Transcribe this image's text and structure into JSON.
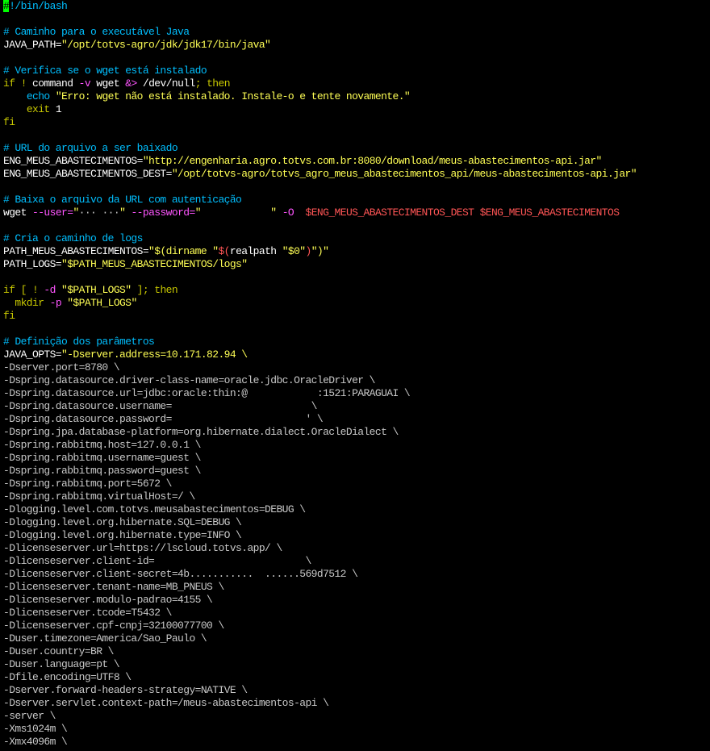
{
  "colors": {
    "background": "#000000",
    "comment": "#00bfff",
    "keyword": "#c8c800",
    "string": "#ffff99",
    "variable": "#ff5555",
    "text": "#ffffff",
    "option": "#c8c8c8",
    "cursor": "#00ff00"
  },
  "lines": [
    [
      {
        "t": "#",
        "c": "cursor"
      },
      {
        "t": "!/bin/bash",
        "c": "cyan"
      }
    ],
    [],
    [
      {
        "t": "# Caminho para o executável Java",
        "c": "cyan"
      }
    ],
    [
      {
        "t": "JAVA_PATH=",
        "c": "white"
      },
      {
        "t": "\"/opt/totvs-agro/jdk/jdk17/bin/java\"",
        "c": "yellow"
      }
    ],
    [],
    [
      {
        "t": "# Verifica se o wget está instalado",
        "c": "cyan"
      }
    ],
    [
      {
        "t": "if ! ",
        "c": "kw"
      },
      {
        "t": "command ",
        "c": "white"
      },
      {
        "t": "-v ",
        "c": "magenta"
      },
      {
        "t": "wget ",
        "c": "white"
      },
      {
        "t": "&> ",
        "c": "magenta"
      },
      {
        "t": "/dev/null",
        "c": "white"
      },
      {
        "t": "; then",
        "c": "kw"
      }
    ],
    [
      {
        "t": "    ",
        "c": "white"
      },
      {
        "t": "echo ",
        "c": "cyan"
      },
      {
        "t": "\"Erro: wget não está instalado. Instale-o e tente novamente.\"",
        "c": "yellow"
      }
    ],
    [
      {
        "t": "    ",
        "c": "white"
      },
      {
        "t": "exit ",
        "c": "kw"
      },
      {
        "t": "1",
        "c": "white"
      }
    ],
    [
      {
        "t": "fi",
        "c": "kw"
      }
    ],
    [],
    [
      {
        "t": "# URL do arquivo a ser baixado",
        "c": "cyan"
      }
    ],
    [
      {
        "t": "ENG_MEUS_ABASTECIMENTOS=",
        "c": "white"
      },
      {
        "t": "\"http://engenharia.agro.totvs.com.br:8080/download/meus-abastecimentos-api.jar\"",
        "c": "yellow"
      }
    ],
    [
      {
        "t": "ENG_MEUS_ABASTECIMENTOS_DEST=",
        "c": "white"
      },
      {
        "t": "\"/opt/totvs-agro/totvs_agro_meus_abastecimentos_api/meus-abastecimentos-api.jar\"",
        "c": "yellow"
      }
    ],
    [],
    [
      {
        "t": "# Baixa o arquivo da URL com autenticação",
        "c": "cyan"
      }
    ],
    [
      {
        "t": "wget ",
        "c": "white"
      },
      {
        "t": "--user=",
        "c": "magenta"
      },
      {
        "t": "\"",
        "c": "yellow"
      },
      {
        "t": "··· ···",
        "c": "dim"
      },
      {
        "t": "\" ",
        "c": "yellow"
      },
      {
        "t": "--password=",
        "c": "magenta"
      },
      {
        "t": "\"            \" ",
        "c": "yellow"
      },
      {
        "t": "-O  ",
        "c": "magenta"
      },
      {
        "t": "$ENG_MEUS_ABASTECIMENTOS_DEST $ENG_MEUS_ABASTECIMENTOS",
        "c": "red"
      }
    ],
    [],
    [
      {
        "t": "# Cria o caminho de logs",
        "c": "cyan"
      }
    ],
    [
      {
        "t": "PATH_MEUS_ABASTECIMENTOS=",
        "c": "white"
      },
      {
        "t": "\"$(dirname \"",
        "c": "yellow"
      },
      {
        "t": "$(",
        "c": "red"
      },
      {
        "t": "realpath ",
        "c": "white"
      },
      {
        "t": "\"$0\"",
        "c": "yellow"
      },
      {
        "t": ")",
        "c": "red"
      },
      {
        "t": "\")\"",
        "c": "yellow"
      }
    ],
    [
      {
        "t": "PATH_LOGS=",
        "c": "white"
      },
      {
        "t": "\"$PATH_MEUS_ABASTECIMENTOS/logs\"",
        "c": "yellow"
      }
    ],
    [],
    [
      {
        "t": "if [ ! ",
        "c": "kw"
      },
      {
        "t": "-d ",
        "c": "magenta"
      },
      {
        "t": "\"$PATH_LOGS\"",
        "c": "yellow"
      },
      {
        "t": " ]; then",
        "c": "kw"
      }
    ],
    [
      {
        "t": "  ",
        "c": "white"
      },
      {
        "t": "mkdir ",
        "c": "kw"
      },
      {
        "t": "-p ",
        "c": "magenta"
      },
      {
        "t": "\"$PATH_LOGS\"",
        "c": "yellow"
      }
    ],
    [
      {
        "t": "fi",
        "c": "kw"
      }
    ],
    [],
    [
      {
        "t": "# Definição dos parâmetros",
        "c": "cyan"
      }
    ],
    [
      {
        "t": "JAVA_OPTS=",
        "c": "white"
      },
      {
        "t": "\"-Dserver.address=10.171.82.94 \\",
        "c": "yellow"
      }
    ],
    [
      {
        "t": "-Dserver.port=8780 \\",
        "c": "gray"
      }
    ],
    [
      {
        "t": "-Dspring.datasource.driver-class-name=oracle.jdbc.OracleDriver \\",
        "c": "gray"
      }
    ],
    [
      {
        "t": "-Dspring.datasource.url=jdbc:oracle:thin:@            :1521:PARAGUAI \\",
        "c": "gray"
      }
    ],
    [
      {
        "t": "-Dspring.datasource.username=                        \\",
        "c": "gray"
      }
    ],
    [
      {
        "t": "-Dspring.datasource.password=                       ' \\",
        "c": "gray"
      }
    ],
    [
      {
        "t": "-Dspring.jpa.database-platform=org.hibernate.dialect.OracleDialect \\",
        "c": "gray"
      }
    ],
    [
      {
        "t": "-Dspring.rabbitmq.host=127.0.0.1 \\",
        "c": "gray"
      }
    ],
    [
      {
        "t": "-Dspring.rabbitmq.username=guest \\",
        "c": "gray"
      }
    ],
    [
      {
        "t": "-Dspring.rabbitmq.password=guest \\",
        "c": "gray"
      }
    ],
    [
      {
        "t": "-Dspring.rabbitmq.port=5672 \\",
        "c": "gray"
      }
    ],
    [
      {
        "t": "-Dspring.rabbitmq.virtualHost=/ \\",
        "c": "gray"
      }
    ],
    [
      {
        "t": "-Dlogging.level.com.totvs.meusabastecimentos=DEBUG \\",
        "c": "gray"
      }
    ],
    [
      {
        "t": "-Dlogging.level.org.hibernate.SQL=DEBUG \\",
        "c": "gray"
      }
    ],
    [
      {
        "t": "-Dlogging.level.org.hibernate.type=INFO \\",
        "c": "gray"
      }
    ],
    [
      {
        "t": "-Dlicenseserver.url=https://lscloud.totvs.app/ \\",
        "c": "gray"
      }
    ],
    [
      {
        "t": "-Dlicenseserver.client-id=                          \\",
        "c": "gray"
      }
    ],
    [
      {
        "t": "-Dlicenseserver.client-secret=4b...........  ......569d7512 \\",
        "c": "gray"
      }
    ],
    [
      {
        "t": "-Dlicenseserver.tenant-name=MB_PNEUS \\",
        "c": "gray"
      }
    ],
    [
      {
        "t": "-Dlicenseserver.modulo-padrao=4155 \\",
        "c": "gray"
      }
    ],
    [
      {
        "t": "-Dlicenseserver.tcode=T5432 \\",
        "c": "gray"
      }
    ],
    [
      {
        "t": "-Dlicenseserver.cpf-cnpj=32100077700 \\",
        "c": "gray"
      }
    ],
    [
      {
        "t": "-Duser.timezone=America/Sao_Paulo \\",
        "c": "gray"
      }
    ],
    [
      {
        "t": "-Duser.country=BR \\",
        "c": "gray"
      }
    ],
    [
      {
        "t": "-Duser.language=pt \\",
        "c": "gray"
      }
    ],
    [
      {
        "t": "-Dfile.encoding=UTF8 \\",
        "c": "gray"
      }
    ],
    [
      {
        "t": "-Dserver.forward-headers-strategy=NATIVE \\",
        "c": "gray"
      }
    ],
    [
      {
        "t": "-Dserver.servlet.context-path=/meus-abastecimentos-api \\",
        "c": "gray"
      }
    ],
    [
      {
        "t": "-server \\",
        "c": "gray"
      }
    ],
    [
      {
        "t": "-Xms1024m \\",
        "c": "gray"
      }
    ],
    [
      {
        "t": "-Xmx4096m \\",
        "c": "gray"
      }
    ]
  ]
}
